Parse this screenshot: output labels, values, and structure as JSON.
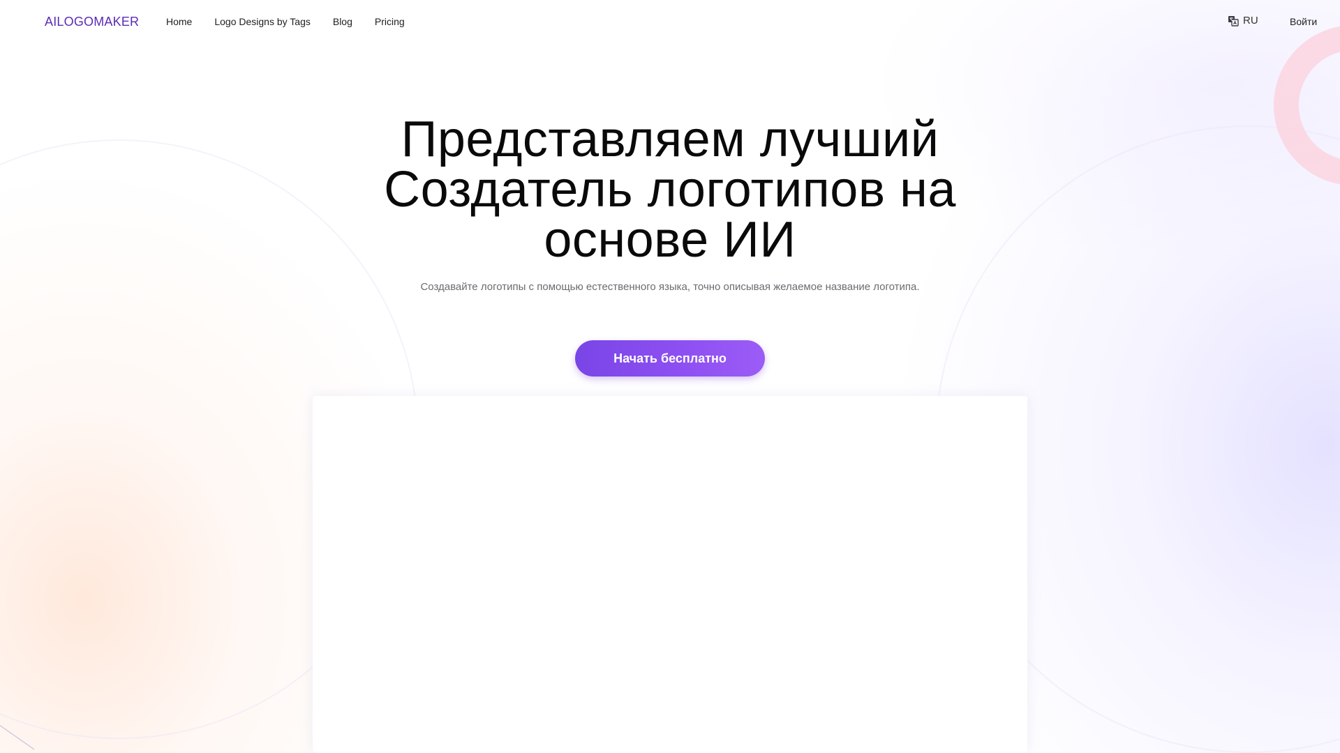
{
  "header": {
    "brand": "AILOGOMAKER",
    "nav": [
      "Home",
      "Logo Designs by Tags",
      "Blog",
      "Pricing"
    ],
    "language": {
      "icon": "translate-icon",
      "label": "RU"
    },
    "login_label": "Войти"
  },
  "hero": {
    "title_lines": [
      "Представляем лучший",
      "Создатель логотипов на",
      "основе ИИ"
    ],
    "subtitle": "Создавайте логотипы с помощью естественного языка, точно описывая желаемое название логотипа.",
    "cta_label": "Начать бесплатно"
  },
  "colors": {
    "brand": "#5b2bb5",
    "cta_start": "#7a45e6",
    "cta_end": "#9b5cf6",
    "subtitle": "#6b6b72"
  }
}
